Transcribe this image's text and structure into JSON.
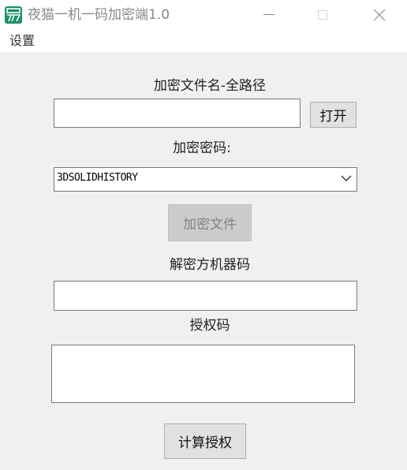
{
  "window": {
    "title": "夜猫一机一码加密端1.0",
    "icon": "app-logo-icon",
    "accent": "#1e8f6b"
  },
  "menu": {
    "settings": "设置"
  },
  "form": {
    "encrypt_file_label": "加密文件名-全路径",
    "encrypt_file_value": "",
    "open_button": "打开",
    "password_label": "加密密码:",
    "password_selected": "3DSOLIDHISTORY",
    "encrypt_button": "加密文件",
    "machine_code_label": "解密方机器码",
    "machine_code_value": "",
    "auth_code_label": "授权码",
    "auth_code_value": "",
    "compute_button": "计算授权"
  }
}
